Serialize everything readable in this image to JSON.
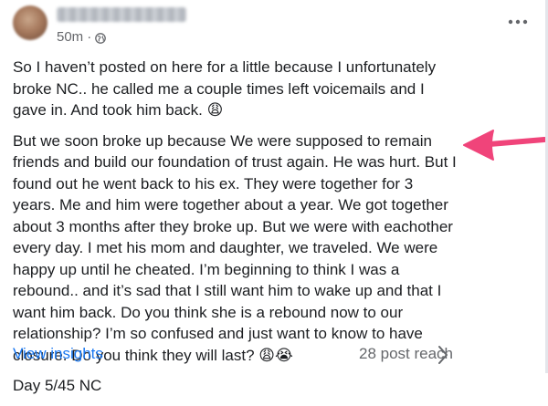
{
  "post": {
    "time": "50m",
    "separator": "·",
    "audience_icon": "globe-icon",
    "menu_icon": "more-horizontal-icon",
    "paragraphs": [
      "So I haven’t posted on here for a little because I unfortunately broke NC.. he called me a couple times left voicemails and I gave in. And took him back. 😩",
      "But we soon broke up because We were supposed to remain friends and build our foundation of trust again. He was hurt. But I found out he went back to his ex. They were together for 3 years. Me and him were together about a year. We got together about 3 months after they broke up. But we were with eachother every day. I met his mom and daughter, we traveled. We were happy up until he cheated. I’m beginning to think I was a rebound.. and it’s sad that I still want him to wake up and that I want him back. Do you think she is a rebound now to our relationship? I’m so confused and just want to know to have closure. Do you think they will last? 😩😭",
      "Day 5/45 NC"
    ]
  },
  "footer": {
    "insights_label": "View insights",
    "reach_label": "28 post reach",
    "chevron_icon": "chevron-right-icon"
  },
  "annotation": {
    "arrow_icon": "pink-arrow-icon",
    "arrow_color": "#f0447a"
  },
  "colors": {
    "link": "#1877f2",
    "secondary_text": "#65676b",
    "body_text": "#1c1e21"
  }
}
